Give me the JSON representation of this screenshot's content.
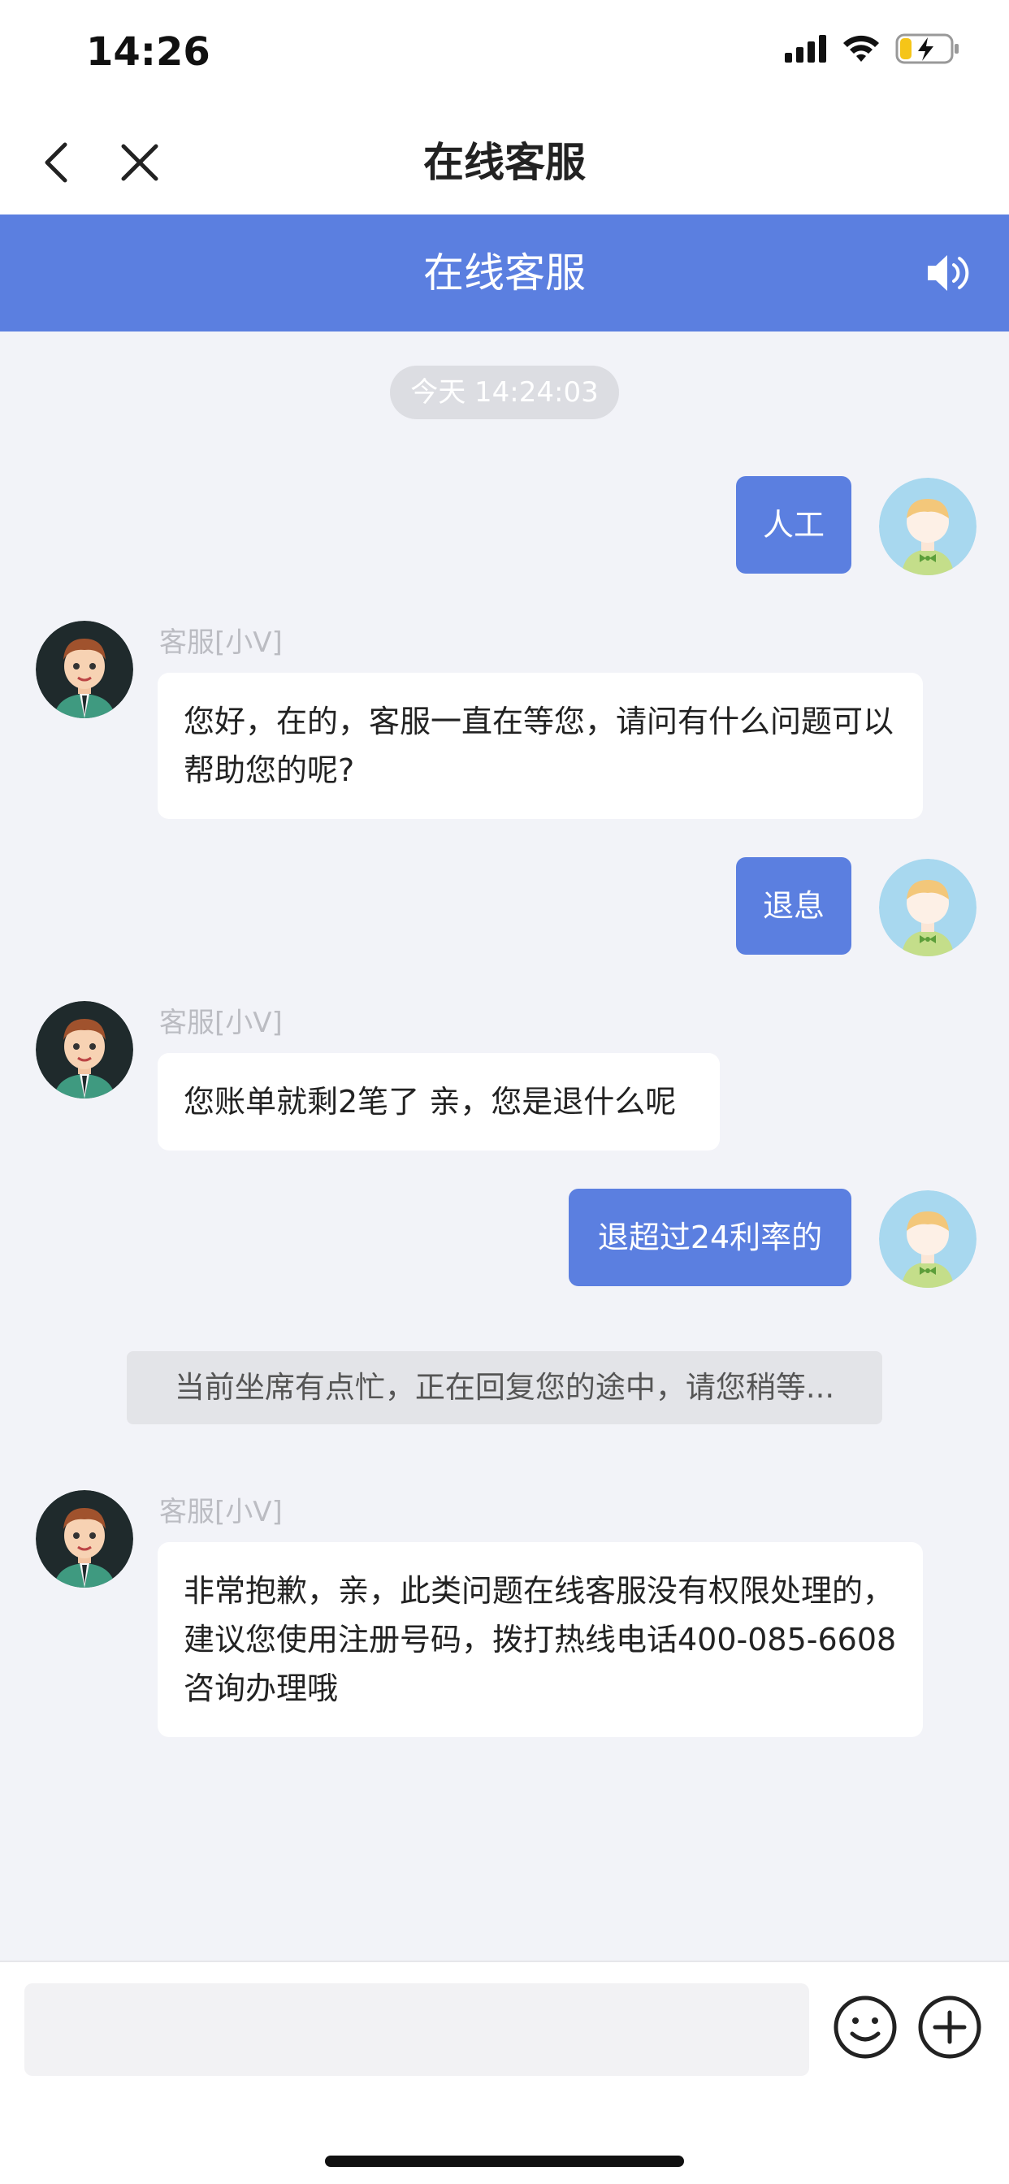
{
  "status_bar": {
    "time": "14:26"
  },
  "nav": {
    "title": "在线客服"
  },
  "chat_header": {
    "title": "在线客服"
  },
  "chat": {
    "timestamp": "今天 14:24:03",
    "messages": [
      {
        "from": "user",
        "text": "人工"
      },
      {
        "from": "agent",
        "name": "客服[小V]",
        "text": "您好，在的，客服一直在等您，请问有什么问题可以帮助您的呢?"
      },
      {
        "from": "user",
        "text": "退息"
      },
      {
        "from": "agent",
        "name": "客服[小V]",
        "text": "您账单就剩2笔了 亲，您是退什么呢"
      },
      {
        "from": "user",
        "text": "退超过24利率的"
      },
      {
        "from": "system",
        "text": "当前坐席有点忙，正在回复您的途中，请您稍等..."
      },
      {
        "from": "agent",
        "name": "客服[小V]",
        "text": "非常抱歉，亲，此类问题在线客服没有权限处理的，建议您使用注册号码，拨打热线电话400-085-6608咨询办理哦"
      }
    ]
  },
  "colors": {
    "accent": "#5b7fe0",
    "background": "#f2f3f8"
  },
  "icons": [
    "back-chevron-icon",
    "close-icon",
    "speaker-icon",
    "emoji-icon",
    "plus-icon"
  ]
}
